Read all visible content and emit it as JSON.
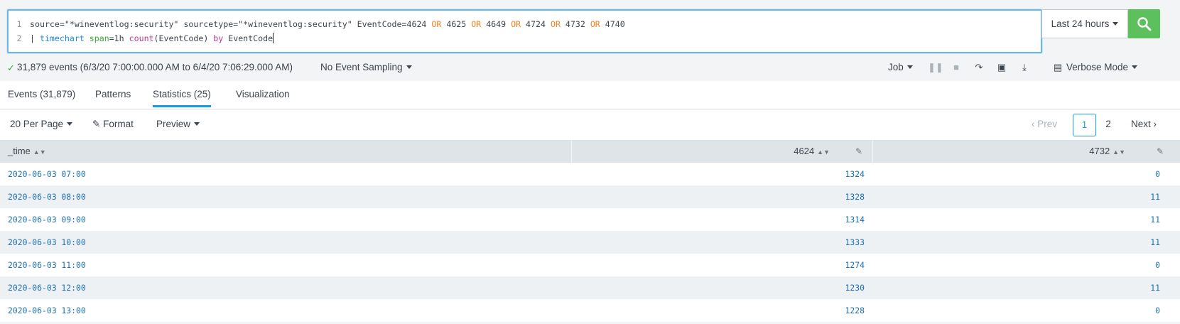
{
  "search": {
    "line_numbers": [
      "1",
      "2"
    ],
    "line1": [
      {
        "t": "plain",
        "v": "source=\"*wineventlog:security\" sourcetype=\"*wineventlog:security\" EventCode=4624 "
      },
      {
        "t": "op",
        "v": "OR"
      },
      {
        "t": "plain",
        "v": " 4625 "
      },
      {
        "t": "op",
        "v": "OR"
      },
      {
        "t": "plain",
        "v": " 4649 "
      },
      {
        "t": "op",
        "v": "OR"
      },
      {
        "t": "plain",
        "v": " 4724 "
      },
      {
        "t": "op",
        "v": "OR"
      },
      {
        "t": "plain",
        "v": " 4732 "
      },
      {
        "t": "op",
        "v": "OR"
      },
      {
        "t": "plain",
        "v": " 4740"
      }
    ],
    "line2": [
      {
        "t": "pipe",
        "v": "| "
      },
      {
        "t": "cmd",
        "v": "timechart"
      },
      {
        "t": "plain",
        "v": " "
      },
      {
        "t": "arg",
        "v": "span"
      },
      {
        "t": "plain",
        "v": "=1h "
      },
      {
        "t": "fn",
        "v": "count"
      },
      {
        "t": "plain",
        "v": "(EventCode) "
      },
      {
        "t": "kw",
        "v": "by"
      },
      {
        "t": "plain",
        "v": " EventCode"
      }
    ],
    "time_range": "Last 24 hours",
    "search_icon": "magnifier-icon",
    "accent_color": "#5cc05c"
  },
  "status": {
    "events_summary": "31,879 events (6/3/20 7:00:00.000 AM to 6/4/20 7:06:29.000 AM)",
    "sampling": "No Event Sampling",
    "job": "Job",
    "mode": "Verbose Mode"
  },
  "tabs": [
    {
      "label": "Events (31,879)",
      "active": false
    },
    {
      "label": "Patterns",
      "active": false
    },
    {
      "label": "Statistics (25)",
      "active": true
    },
    {
      "label": "Visualization",
      "active": false
    }
  ],
  "toolbar": {
    "per_page": "20 Per Page",
    "format": "Format",
    "preview": "Preview",
    "prev": "Prev",
    "pages": [
      "1",
      "2"
    ],
    "next": "Next"
  },
  "table": {
    "columns": [
      "_time",
      "4624",
      "4732"
    ],
    "rows": [
      [
        "2020-06-03 07:00",
        "1324",
        "0"
      ],
      [
        "2020-06-03 08:00",
        "1328",
        "11"
      ],
      [
        "2020-06-03 09:00",
        "1314",
        "11"
      ],
      [
        "2020-06-03 10:00",
        "1333",
        "11"
      ],
      [
        "2020-06-03 11:00",
        "1274",
        "0"
      ],
      [
        "2020-06-03 12:00",
        "1230",
        "11"
      ],
      [
        "2020-06-03 13:00",
        "1228",
        "0"
      ]
    ]
  }
}
